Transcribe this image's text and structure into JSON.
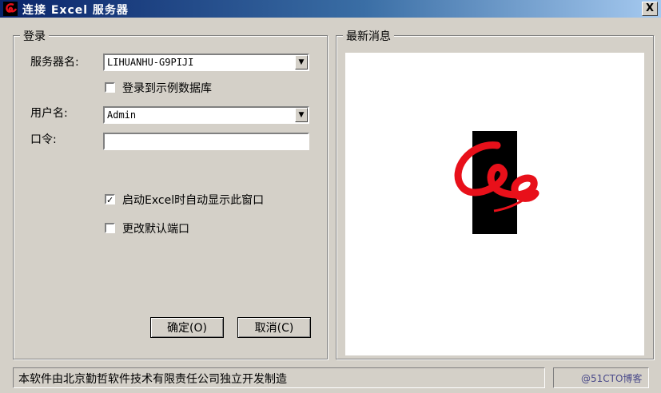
{
  "window": {
    "title": "连接 Excel 服务器",
    "close_label": "X"
  },
  "login_group": {
    "legend": "登录",
    "server_label": "服务器名:",
    "server_value": "LIHUANHU-G9PIJI",
    "sample_db_label": "登录到示例数据库",
    "sample_db_checked": false,
    "user_label": "用户名:",
    "user_value": "Admin",
    "password_label": "口令:",
    "password_value": "",
    "autostart_label": "启动Excel时自动显示此窗口",
    "autostart_checked": true,
    "change_port_label": "更改默认端口",
    "change_port_checked": false,
    "ok_label": "确定(O)",
    "cancel_label": "取消(C)"
  },
  "news_group": {
    "legend": "最新消息"
  },
  "status_bar": {
    "text": "本软件由北京勤哲软件技术有限责任公司独立开发制造",
    "watermark": "@51CTO博客"
  },
  "colors": {
    "title_gradient_start": "#0a246a",
    "logo_red": "#e8101a",
    "logo_bg": "#000000"
  }
}
